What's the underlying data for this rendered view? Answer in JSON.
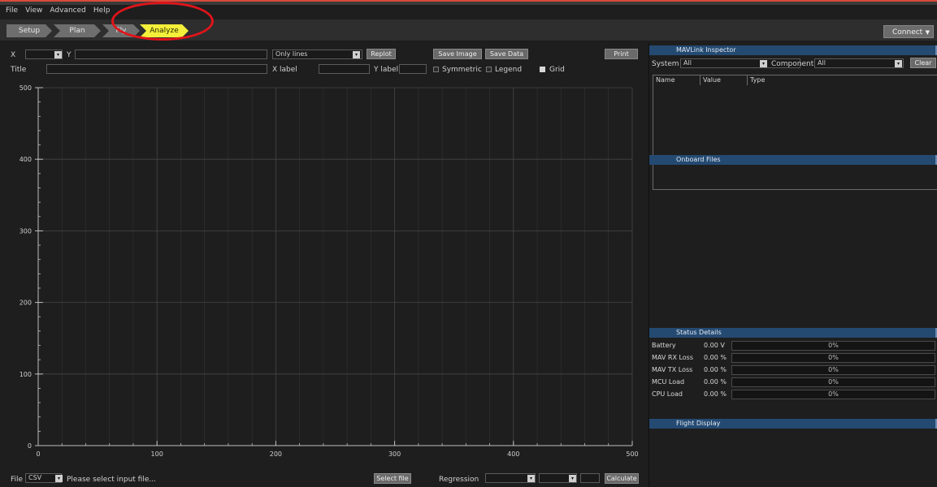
{
  "menu": [
    "File",
    "View",
    "Advanced",
    "Help"
  ],
  "nav": {
    "tabs": [
      {
        "label": "Setup",
        "active": false
      },
      {
        "label": "Plan",
        "active": false
      },
      {
        "label": "Fly",
        "active": false
      },
      {
        "label": "Analyze",
        "active": true
      }
    ],
    "connect_label": "Connect",
    "connect_caret": "▼"
  },
  "plot_controls": {
    "x_label": "X",
    "x_value": "",
    "y_label": "Y",
    "y_value": "",
    "style_value": "Only lines",
    "replot": "Replot",
    "save_image": "Save Image",
    "save_data": "Save Data",
    "print": "Print",
    "title_label": "Title",
    "title_value": "",
    "xlabel_label": "X label",
    "xlabel_value": "",
    "ylabel_label": "Y label",
    "ylabel_value": "",
    "symmetric": {
      "label": "Symmetric",
      "checked": false
    },
    "legend": {
      "label": "Legend",
      "checked": false
    },
    "grid": {
      "label": "Grid",
      "checked": true
    }
  },
  "chart_data": {
    "type": "line",
    "series": [],
    "title": "",
    "xlabel": "",
    "ylabel": "",
    "xlim": [
      0,
      500
    ],
    "ylim": [
      0,
      500
    ],
    "xticks": [
      0,
      100,
      200,
      300,
      400,
      500
    ],
    "yticks": [
      0,
      100,
      200,
      300,
      400,
      500
    ],
    "grid": true,
    "grid_color": "#4a4a4a",
    "axis_color": "#bdbdbd"
  },
  "bottom_bar": {
    "file_label": "File",
    "file_type": "CSV",
    "file_placeholder": "Please select input file...",
    "select_file": "Select file",
    "regression_label": "Regression",
    "calculate": "Calculate"
  },
  "right_panel": {
    "mavlink": {
      "title": "MAVLink Inspector",
      "system_label": "System",
      "system_value": "All",
      "component_label": "Component",
      "component_value": "All",
      "clear": "Clear",
      "columns": [
        "Name",
        "Value",
        "Type"
      ]
    },
    "onboard_files": {
      "title": "Onboard Files"
    },
    "status": {
      "title": "Status Details",
      "rows": [
        {
          "label": "Battery",
          "value": "0.00 V",
          "percent": "0%"
        },
        {
          "label": "MAV RX Loss",
          "value": "0.00 %",
          "percent": "0%"
        },
        {
          "label": "MAV TX Loss",
          "value": "0.00 %",
          "percent": "0%"
        },
        {
          "label": "MCU Load",
          "value": "0.00 %",
          "percent": "0%"
        },
        {
          "label": "CPU Load",
          "value": "0.00 %",
          "percent": "0%"
        }
      ]
    },
    "flight_display": {
      "title": "Flight Display"
    }
  },
  "colors": {
    "accent_active_tab": "#f4ef3a",
    "panel_header": "#244a72",
    "annotation_circle": "#e0141a"
  }
}
